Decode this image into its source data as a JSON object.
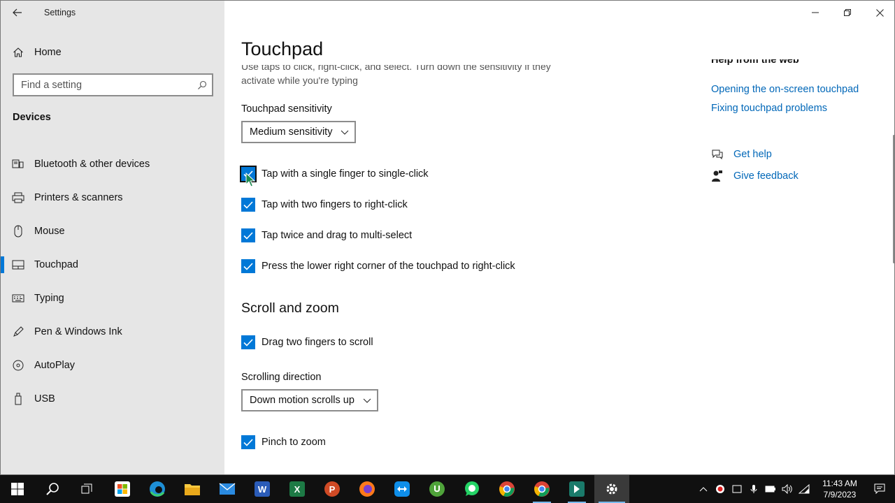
{
  "window": {
    "title": "Settings"
  },
  "sidebar": {
    "home_label": "Home",
    "search_placeholder": "Find a setting",
    "section_label": "Devices",
    "items": [
      {
        "label": "Bluetooth & other devices",
        "icon": "bluetooth-devices-icon"
      },
      {
        "label": "Printers & scanners",
        "icon": "printer-icon"
      },
      {
        "label": "Mouse",
        "icon": "mouse-icon"
      },
      {
        "label": "Touchpad",
        "icon": "touchpad-icon",
        "active": true
      },
      {
        "label": "Typing",
        "icon": "keyboard-icon"
      },
      {
        "label": "Pen & Windows Ink",
        "icon": "pen-icon"
      },
      {
        "label": "AutoPlay",
        "icon": "autoplay-icon"
      },
      {
        "label": "USB",
        "icon": "usb-icon"
      }
    ]
  },
  "main": {
    "title": "Touchpad",
    "description": "Use taps to click, right-click, and select. Turn down the sensitivity if they activate while you're typing",
    "sensitivity": {
      "label": "Touchpad sensitivity",
      "value": "Medium sensitivity"
    },
    "taps": [
      {
        "label": "Tap with a single finger to single-click",
        "checked": true
      },
      {
        "label": "Tap with two fingers to right-click",
        "checked": true
      },
      {
        "label": "Tap twice and drag to multi-select",
        "checked": true
      },
      {
        "label": "Press the lower right corner of the touchpad to right-click",
        "checked": true
      }
    ],
    "scroll_heading": "Scroll and zoom",
    "drag_scroll": {
      "label": "Drag two fingers to scroll",
      "checked": true
    },
    "scroll_direction": {
      "label": "Scrolling direction",
      "value": "Down motion scrolls up"
    },
    "pinch_zoom": {
      "label": "Pinch to zoom",
      "checked": true
    }
  },
  "help": {
    "heading": "Help from the web",
    "links": [
      "Opening the on-screen touchpad",
      "Fixing touchpad problems"
    ],
    "get_help": "Get help",
    "give_feedback": "Give feedback"
  },
  "taskbar": {
    "time": "11:43 AM",
    "date": "7/9/2023"
  },
  "colors": {
    "accent": "#0078d7",
    "link": "#0067b8",
    "sidebar_bg": "#e6e6e6",
    "taskbar_bg": "#101010"
  }
}
